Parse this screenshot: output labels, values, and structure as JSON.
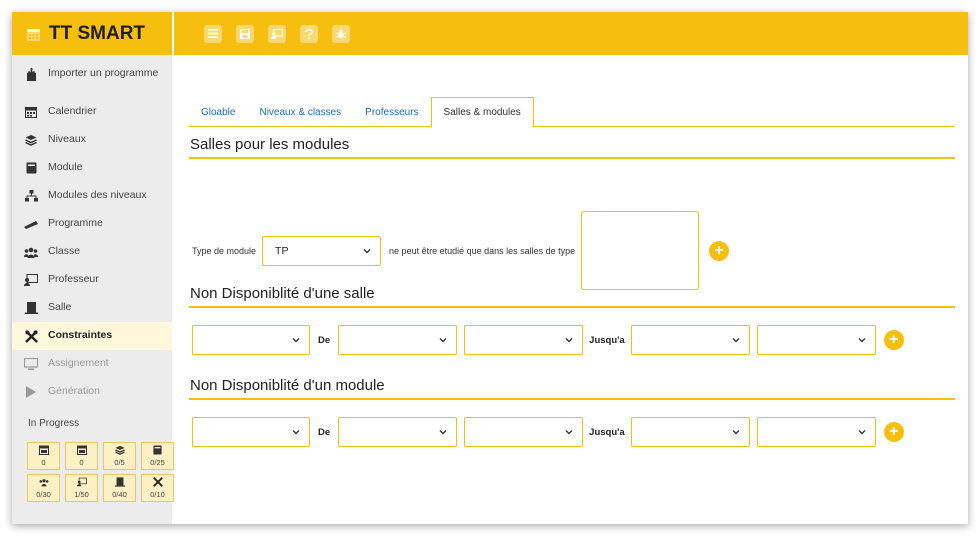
{
  "app": {
    "title": "TT SMART"
  },
  "sidebar": {
    "items": [
      {
        "label": "Importer un programme",
        "icon": "import-icon",
        "state": "normal"
      },
      {
        "label": "Calendrier",
        "icon": "calendar-icon",
        "state": "normal"
      },
      {
        "label": "Niveaux",
        "icon": "layers-icon",
        "state": "normal"
      },
      {
        "label": "Module",
        "icon": "book-icon",
        "state": "normal"
      },
      {
        "label": "Modules des niveaux",
        "icon": "hierarchy-icon",
        "state": "normal"
      },
      {
        "label": "Programme",
        "icon": "ruler-icon",
        "state": "normal"
      },
      {
        "label": "Classe",
        "icon": "users-icon",
        "state": "normal"
      },
      {
        "label": "Professeur",
        "icon": "teacher-icon",
        "state": "normal"
      },
      {
        "label": "Salle",
        "icon": "room-icon",
        "state": "normal"
      },
      {
        "label": "Constraintes",
        "icon": "tools-icon",
        "state": "active"
      },
      {
        "label": "Assignement",
        "icon": "monitor-icon",
        "state": "disabled"
      },
      {
        "label": "Génération",
        "icon": "play-icon",
        "state": "disabled"
      }
    ],
    "progress_title": "In Progress",
    "progress": [
      {
        "icon": "calendar-icon",
        "value": "0"
      },
      {
        "icon": "calendar-icon",
        "value": "0"
      },
      {
        "icon": "layers-icon",
        "value": "0/5"
      },
      {
        "icon": "book-icon",
        "value": "0/25"
      },
      {
        "icon": "users-icon",
        "value": "0/30"
      },
      {
        "icon": "teacher-icon",
        "value": "1/50"
      },
      {
        "icon": "room-icon",
        "value": "0/40"
      },
      {
        "icon": "tools-icon",
        "value": "0/10"
      }
    ]
  },
  "toolbar": {
    "buttons": [
      "menu-icon",
      "save-icon",
      "teacher-icon",
      "help-icon",
      "bug-icon"
    ]
  },
  "tabs": [
    "Gloable",
    "Niveaux & classes",
    "Professeurs",
    "Salles & modules"
  ],
  "active_tab": "Salles & modules",
  "section1": {
    "title": "Salles pour les modules",
    "type_label": "Type de module",
    "type_value": "TP",
    "text": "ne peut être etudié que dans les salles de type"
  },
  "section2": {
    "title": "Non Disponiblité d'une salle",
    "de_label": "De",
    "jusqua_label": "Jusqu'a"
  },
  "section3": {
    "title": "Non Disponiblité d'un module",
    "de_label": "De",
    "jusqua_label": "Jusqu'a"
  },
  "colors": {
    "accent": "#f6be0f",
    "link": "#1b6dc1",
    "sidebar_bg": "#ececec"
  }
}
